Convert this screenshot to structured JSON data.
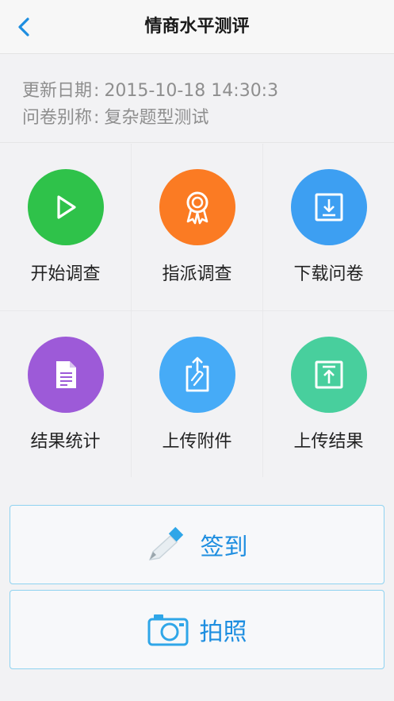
{
  "navbar": {
    "title": "情商水平测评",
    "back_icon": "chevron-left-icon"
  },
  "info": {
    "update_label": "更新日期",
    "update_value": "2015-10-18 14:30:3",
    "alias_label": "问卷别称",
    "alias_value": "复杂题型测试",
    "separator": ":"
  },
  "grid": {
    "items": [
      {
        "label": "开始调查",
        "icon": "play-icon",
        "color": "#2fc24a"
      },
      {
        "label": "指派调查",
        "icon": "award-icon",
        "color": "#fb7b23"
      },
      {
        "label": "下载问卷",
        "icon": "download-icon",
        "color": "#3d9ff2"
      },
      {
        "label": "结果统计",
        "icon": "document-icon",
        "color": "#9d5ad8"
      },
      {
        "label": "上传附件",
        "icon": "attachment-upload-icon",
        "color": "#46abf7"
      },
      {
        "label": "上传结果",
        "icon": "upload-icon",
        "color": "#48cf9d"
      }
    ]
  },
  "actions": {
    "signin_label": "签到",
    "signin_icon": "pen-icon",
    "photo_label": "拍照",
    "photo_icon": "camera-icon",
    "accent": "#1e8ee0"
  }
}
